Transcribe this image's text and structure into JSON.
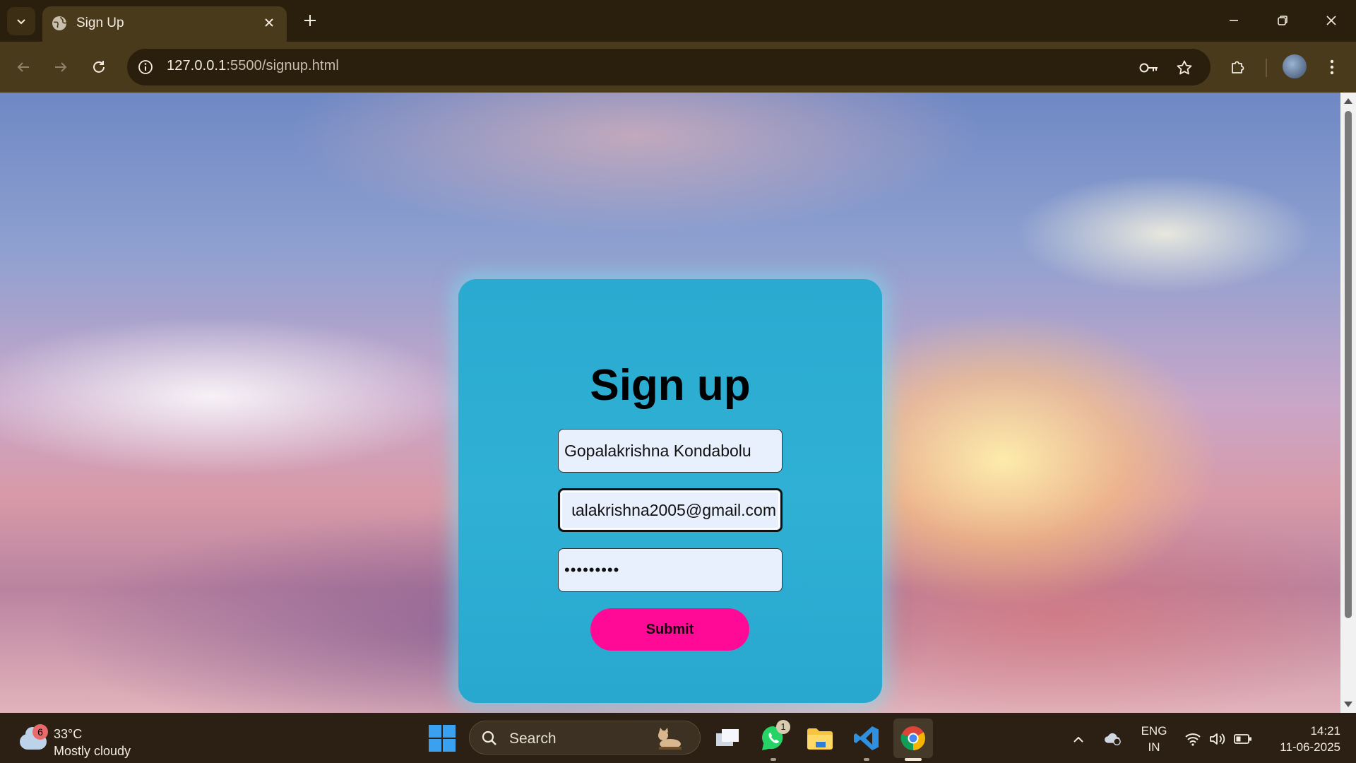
{
  "browser": {
    "tab": {
      "title": "Sign Up"
    },
    "address": {
      "host": "127.0.0.1",
      "rest": ":5500/signup.html"
    }
  },
  "form": {
    "heading": "Sign up",
    "name_value": "Gopalakrishna Kondabolu",
    "email_value": "ɩalakrishna2005@gmail.com",
    "password_value": "•••••••••",
    "submit_label": "Submit",
    "colors": {
      "card": "#2fb0d4",
      "submit": "#ff0a96",
      "field_bg": "#e9f0fd"
    }
  },
  "taskbar": {
    "weather": {
      "badge": "6",
      "temp": "33°C",
      "condition": "Mostly cloudy"
    },
    "search_label": "Search",
    "whatsapp_badge": "1",
    "lang_line1": "ENG",
    "lang_line2": "IN",
    "time": "14:21",
    "date": "11-06-2025"
  }
}
